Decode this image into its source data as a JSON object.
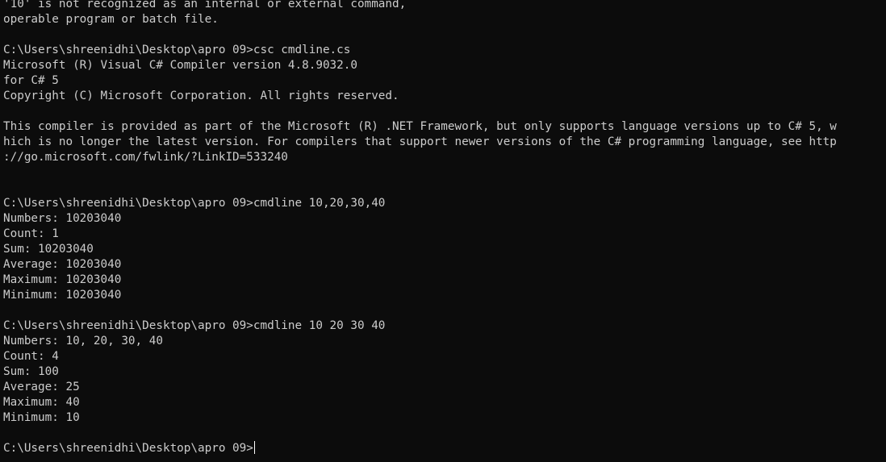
{
  "colors": {
    "background": "#0c0c0c",
    "foreground": "#cccccc",
    "cursor": "#ffffff"
  },
  "lines": [
    "'10' is not recognized as an internal or external command,",
    "operable program or batch file.",
    "",
    "C:\\Users\\shreenidhi\\Desktop\\apro 09>csc cmdline.cs",
    "Microsoft (R) Visual C# Compiler version 4.8.9032.0",
    "for C# 5",
    "Copyright (C) Microsoft Corporation. All rights reserved.",
    "",
    "This compiler is provided as part of the Microsoft (R) .NET Framework, but only supports language versions up to C# 5, w",
    "hich is no longer the latest version. For compilers that support newer versions of the C# programming language, see http",
    "://go.microsoft.com/fwlink/?LinkID=533240",
    "",
    "",
    "C:\\Users\\shreenidhi\\Desktop\\apro 09>cmdline 10,20,30,40",
    "Numbers: 10203040",
    "Count: 1",
    "Sum: 10203040",
    "Average: 10203040",
    "Maximum: 10203040",
    "Minimum: 10203040",
    "",
    "C:\\Users\\shreenidhi\\Desktop\\apro 09>cmdline 10 20 30 40",
    "Numbers: 10, 20, 30, 40",
    "Count: 4",
    "Sum: 100",
    "Average: 25",
    "Maximum: 40",
    "Minimum: 10",
    ""
  ],
  "prompt": "C:\\Users\\shreenidhi\\Desktop\\apro 09>"
}
